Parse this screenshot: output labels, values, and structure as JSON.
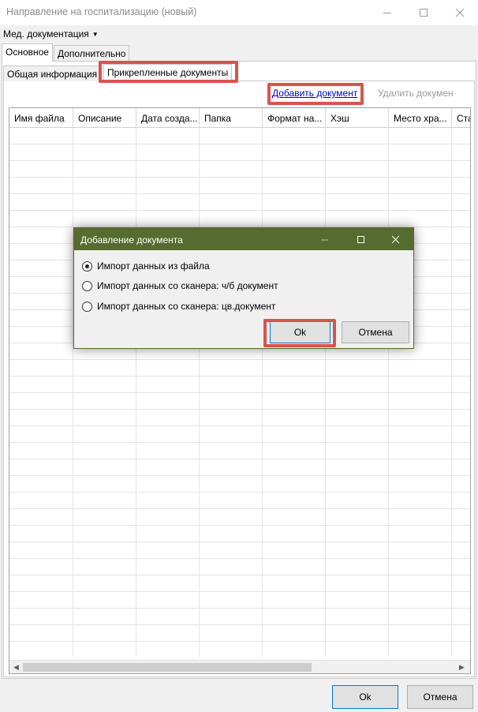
{
  "window": {
    "title": "Направление на госпитализацию (новый)"
  },
  "menu": {
    "label": "Мед. документация"
  },
  "outer_tabs": [
    {
      "label": "Основное",
      "active": true
    },
    {
      "label": "Дополнительно",
      "active": false
    }
  ],
  "inner_tabs": [
    {
      "label": "Общая информация",
      "active": false
    },
    {
      "label": "Прикрепленные документы",
      "active": true
    }
  ],
  "toolbar": {
    "add_document": "Добавить документ",
    "delete_document": "Удалить документ"
  },
  "table": {
    "columns": [
      "Имя файла",
      "Описание",
      "Дата созда...",
      "Папка",
      "Формат на...",
      "Хэш",
      "Место хра...",
      "Ста"
    ]
  },
  "dialog": {
    "title": "Добавление документа",
    "options": [
      {
        "label": "Импорт данных из файла",
        "selected": true
      },
      {
        "label": "Импорт данных со сканера: ч/б документ",
        "selected": false
      },
      {
        "label": "Импорт данных со сканера: цв.документ",
        "selected": false
      }
    ],
    "ok_label": "Ok",
    "cancel_label": "Отмена"
  },
  "footer": {
    "ok_label": "Ok",
    "cancel_label": "Отмена"
  },
  "colors": {
    "dialog_title_bg": "#556b2f",
    "highlight": "#d9534f",
    "link": "#0000cc"
  }
}
